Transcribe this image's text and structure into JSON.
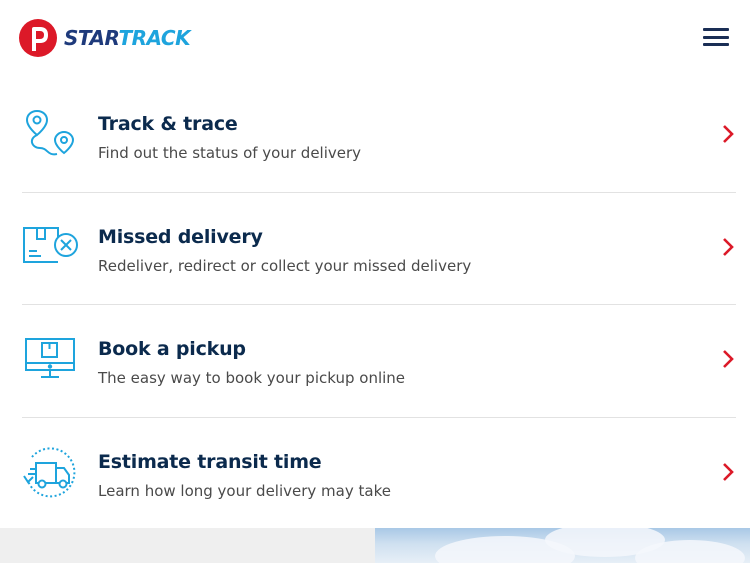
{
  "header": {
    "logo_text_part1": "STAR",
    "logo_text_part2": "TRACK",
    "logo_icon": "startrack-logo-icon",
    "menu_icon": "hamburger-menu-icon"
  },
  "colors": {
    "navy": "#0b2a4d",
    "accent_blue": "#1ea4dd",
    "brand_red": "#dc1928",
    "divider": "#e2e2e2"
  },
  "services": [
    {
      "title": "Track & trace",
      "description": "Find out the status of your delivery",
      "icon": "map-route-pin-icon"
    },
    {
      "title": "Missed delivery",
      "description": "Redeliver, redirect or collect your missed delivery",
      "icon": "missed-parcel-icon"
    },
    {
      "title": "Book a pickup",
      "description": "The easy way to book your pickup online",
      "icon": "monitor-parcel-icon"
    },
    {
      "title": "Estimate transit time",
      "description": "Learn how long your delivery may take",
      "icon": "truck-cycle-icon"
    }
  ]
}
